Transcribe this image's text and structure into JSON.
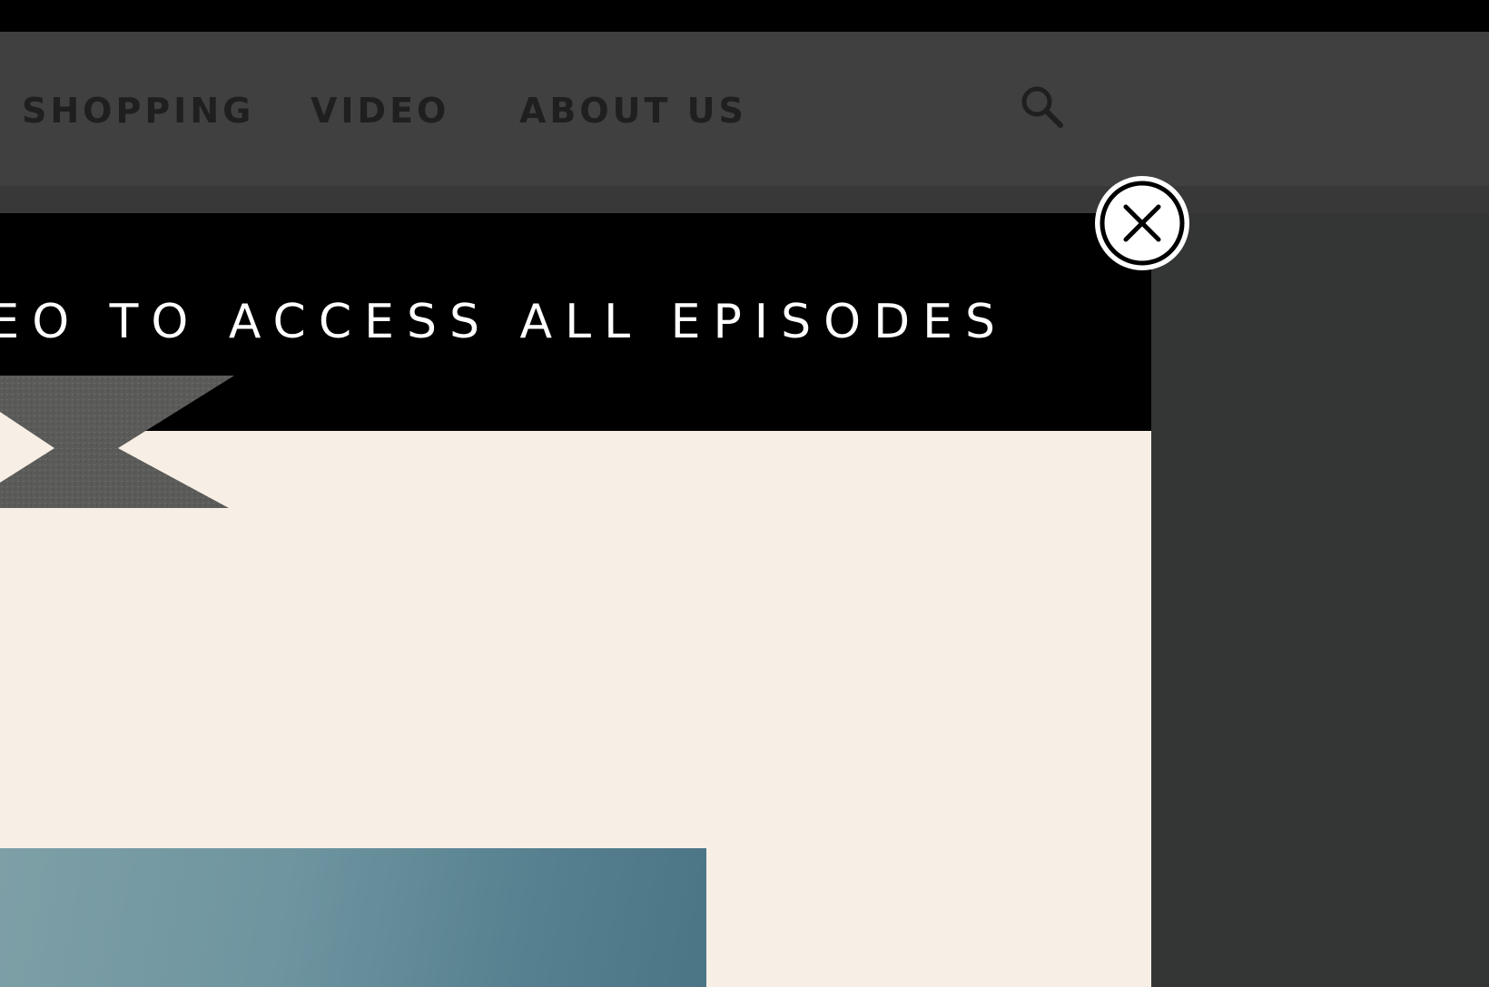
{
  "nav": {
    "items": [
      {
        "label": "SHOPPING"
      },
      {
        "label": "VIDEO"
      },
      {
        "label": "ABOUT US"
      }
    ],
    "search_icon": "search-icon"
  },
  "modal": {
    "heading": "VIDEO TO ACCESS ALL EPISODES",
    "close_icon": "close-circle-icon",
    "brand_mark_icon": "brand-x-logo",
    "thumbnail": "video-thumbnail"
  },
  "colors": {
    "overlay": "#343535",
    "navbar": "#404040",
    "modal_header": "#000000",
    "modal_body": "#f7efe5",
    "nav_text": "#1f1f1f",
    "heading_text": "#ffffff",
    "thumbnail": "#5e8a97"
  }
}
